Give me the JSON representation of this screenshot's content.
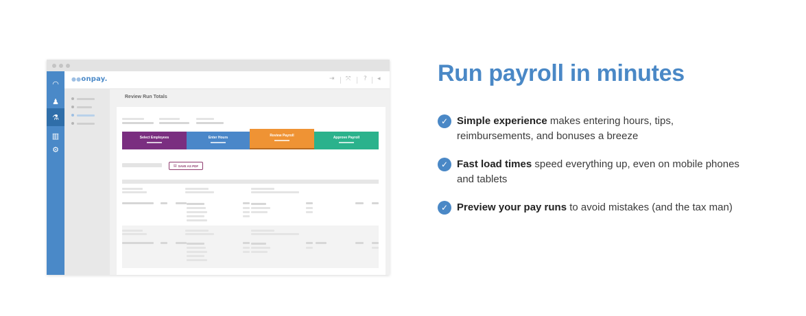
{
  "colors": {
    "brand_blue": "#4a88c6",
    "rail_active": "#2f6ea9",
    "step_select": "#7a2e80",
    "step_enter": "#4a87c9",
    "step_review": "#ef9334",
    "step_approve": "#2bb28c",
    "pdf_button": "#8e3a6e"
  },
  "app": {
    "logo": "onpay.",
    "left_rail_icons": [
      "dashboard-icon",
      "people-icon",
      "payroll-icon",
      "reports-icon",
      "gear-icon"
    ],
    "top_icons": [
      "logout-icon",
      "expand-icon",
      "help-icon",
      "megaphone-icon"
    ],
    "page_title": "Review Run Totals",
    "steps": [
      {
        "label": "Select Employees"
      },
      {
        "label": "Enter Hours"
      },
      {
        "label": "Review Payroll"
      },
      {
        "label": "Approve Payroll"
      }
    ],
    "pdf_button": "SAVE AS PDF"
  },
  "marketing": {
    "headline": "Run payroll in minutes",
    "features": [
      {
        "bold": "Simple experience",
        "rest": " makes entering hours, tips, reimbursements, and bonuses a breeze"
      },
      {
        "bold": "Fast load times",
        "rest": " speed everything up, even on mobile phones and tablets"
      },
      {
        "bold": "Preview your pay runs",
        "rest": " to avoid mistakes (and the tax man)"
      }
    ]
  }
}
